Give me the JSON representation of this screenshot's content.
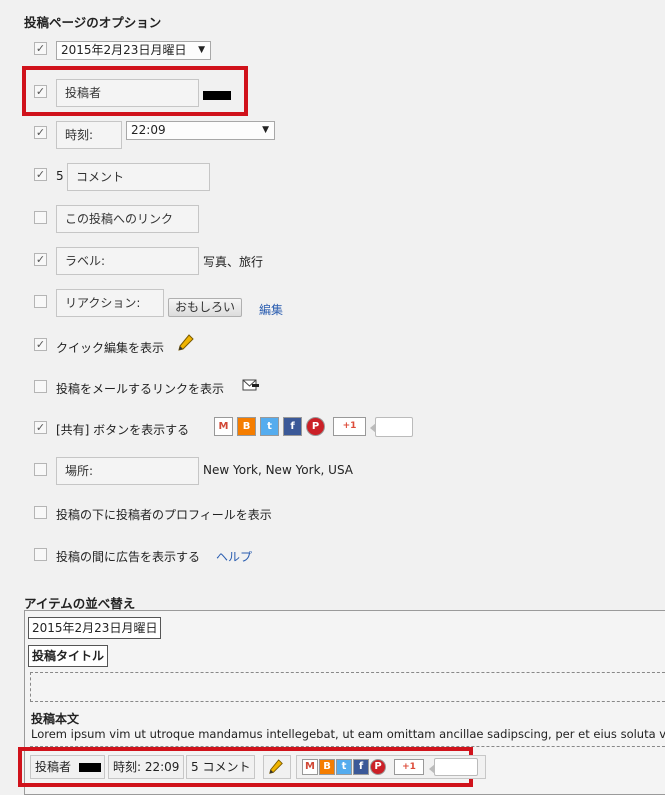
{
  "options": {
    "heading": "投稿ページのオプション",
    "date_select": "2015年2月23日月曜日",
    "author_label": "投稿者",
    "time_label": "時刻:",
    "time_select": "22:09",
    "comment_count": "5",
    "comment_label": "コメント",
    "permalink_label": "この投稿へのリンク",
    "labels_label": "ラベル:",
    "labels_value": "写真、旅行",
    "reactions_label": "リアクション:",
    "reactions_button": "おもしろい",
    "reactions_edit": "編集",
    "quick_edit": "クイック編集を表示",
    "email_link": "投稿をメールするリンクを表示",
    "share_label": "[共有] ボタンを表示する",
    "share_buttons": [
      "gmail-icon",
      "blogger-icon",
      "twitter-icon",
      "facebook-icon",
      "pinterest-icon",
      "google-plus-one-icon"
    ],
    "plus_one": "+1",
    "location_label": "場所:",
    "location_value": "New York, New York, USA",
    "author_profile": "投稿の下に投稿者のプロフィールを表示",
    "ads_label": "投稿の間に広告を表示する",
    "ads_help": "ヘルプ",
    "checked": {
      "date": true,
      "author": true,
      "time": true,
      "comments": true,
      "permalink": false,
      "labels": true,
      "reactions": false,
      "quick_edit": true,
      "email": false,
      "share": true,
      "location": false,
      "profile": false,
      "ads": false
    }
  },
  "arrange": {
    "heading": "アイテムの並べ替え",
    "date": "2015年2月23日月曜日",
    "post_title": "投稿タイトル",
    "body_title": "投稿本文",
    "body_text": "Lorem ipsum vim ut utroque mandamus intellegebat, ut eam omittam ancillae sadipscing, per et eius soluta ve",
    "footer": {
      "author": "投稿者",
      "time": "時刻: 22:09",
      "comments": "5 コメント",
      "plus_one": "+1"
    }
  },
  "colors": {
    "highlight": "#d0121b",
    "link": "#2a5db0",
    "gmail": "#d14836",
    "blogger": "#f57d00",
    "twitter": "#55acee",
    "facebook": "#3b5998",
    "pinterest": "#cb2027",
    "gplus": "#dd4b39"
  }
}
